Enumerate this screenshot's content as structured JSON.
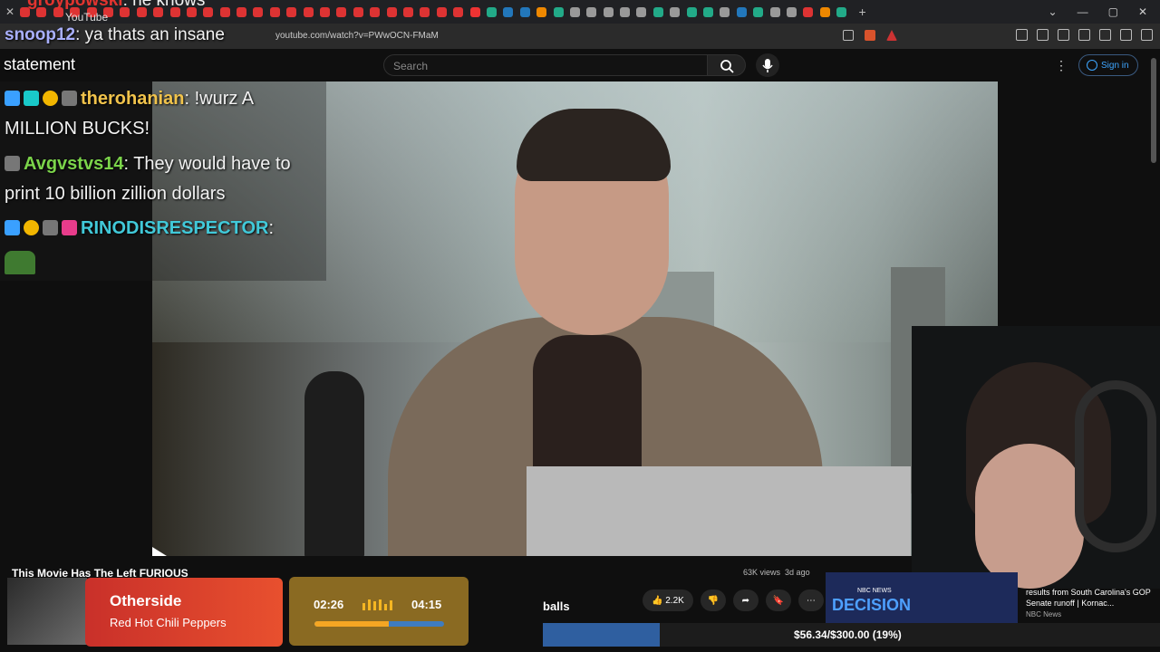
{
  "browser": {
    "url": "youtube.com/watch?v=PWwOCN-FMaM"
  },
  "youtube": {
    "logo_text": "YouTube",
    "search_placeholder": "Search",
    "signin_label": "Sign in",
    "video_title": "This Movie Has The Left FURIOUS",
    "views": "63K views",
    "age": "3d ago",
    "like_count": "2.2K"
  },
  "chat": {
    "top_partial_user": "groypowski",
    "top_partial_text": ": he knows",
    "top_user": "snoop12",
    "top_text": ": ya thats an insane",
    "statement_text": "statement",
    "lines": [
      {
        "user": "therohanian",
        "color": "#f1c34b",
        "text_line1": ": !wurz A",
        "text_line2": "MILLION BUCKS!"
      },
      {
        "user": "Avgvstvs14",
        "color": "#7bd44a",
        "text_line1": ": They would have to",
        "text_line2": "print 10 billion zillion dollars"
      },
      {
        "user": "RINODISRESPECTOR",
        "color": "#41c9d9",
        "text_line1": ":",
        "text_line2": ""
      }
    ]
  },
  "now_playing": {
    "title": "Otherside",
    "artist": "Red Hot Chili Peppers",
    "current_time": "02:26",
    "total_time": "04:15",
    "progress": 0.57
  },
  "overlay": {
    "balls_text": "balls"
  },
  "donation_goal": {
    "text": "$56.34/$300.00 (19%)",
    "fraction": 0.19
  },
  "news": {
    "label": "NBC NEWS",
    "decision_text": "DECISION",
    "title": "results from South Carolina's GOP Senate runoff | Kornac...",
    "source": "NBC News"
  },
  "colors": {
    "accent_blue": "#3ea6ff",
    "now_playing_red": "#c9302a",
    "goal_blue": "#2f5fa0"
  }
}
